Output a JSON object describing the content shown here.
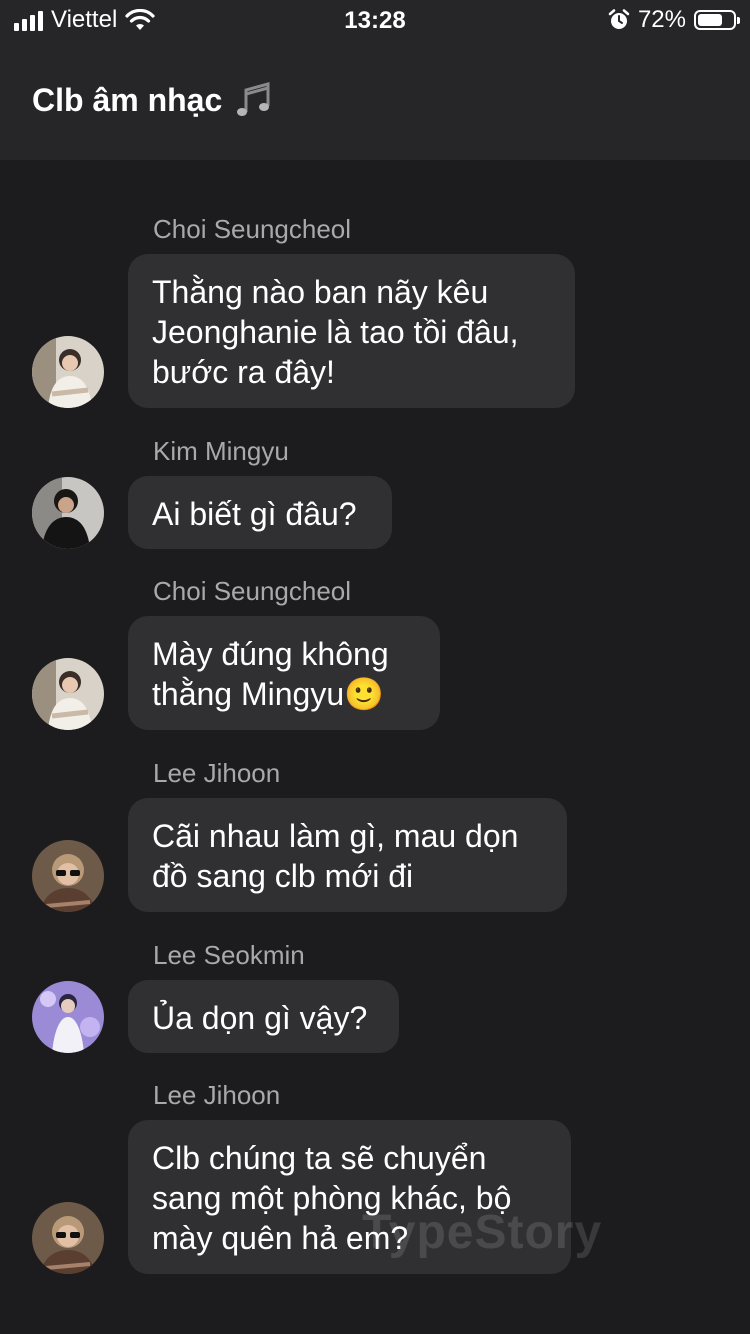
{
  "status": {
    "carrier": "Viettel",
    "time": "13:28",
    "battery_percent": "72%",
    "battery_level": 0.72,
    "icons": [
      "signal-icon",
      "wifi-icon",
      "alarm-icon",
      "battery-icon"
    ]
  },
  "header": {
    "title": "Clb âm nhạc",
    "title_icon": "music-notes-icon"
  },
  "messages": [
    {
      "sender": "Choi Seungcheol",
      "text": "Thằng nào ban nãy kêu\nJeonghanie là tao tồi đâu,\nbước ra đây!",
      "avatar": "avatar-choi-seungcheol"
    },
    {
      "sender": "Kim Mingyu",
      "text": "Ai biết gì đâu?",
      "avatar": "avatar-kim-mingyu"
    },
    {
      "sender": "Choi Seungcheol",
      "text": "Mày đúng không\nthằng Mingyu🙂",
      "avatar": "avatar-choi-seungcheol"
    },
    {
      "sender": "Lee Jihoon",
      "text": "Cãi nhau làm gì, mau dọn\nđồ sang clb mới đi",
      "avatar": "avatar-lee-jihoon"
    },
    {
      "sender": "Lee Seokmin",
      "text": "Ủa dọn gì vậy?",
      "avatar": "avatar-lee-seokmin"
    },
    {
      "sender": "Lee Jihoon",
      "text": "Clb chúng ta sẽ chuyển\nsang một phòng khác, bộ\nmày quên hả em?",
      "avatar": "avatar-lee-jihoon"
    }
  ],
  "watermark": "TypeStory",
  "colors": {
    "background": "#1c1c1e",
    "header": "#262628",
    "bubble": "#303032",
    "sender_name": "#a8a8ad"
  }
}
